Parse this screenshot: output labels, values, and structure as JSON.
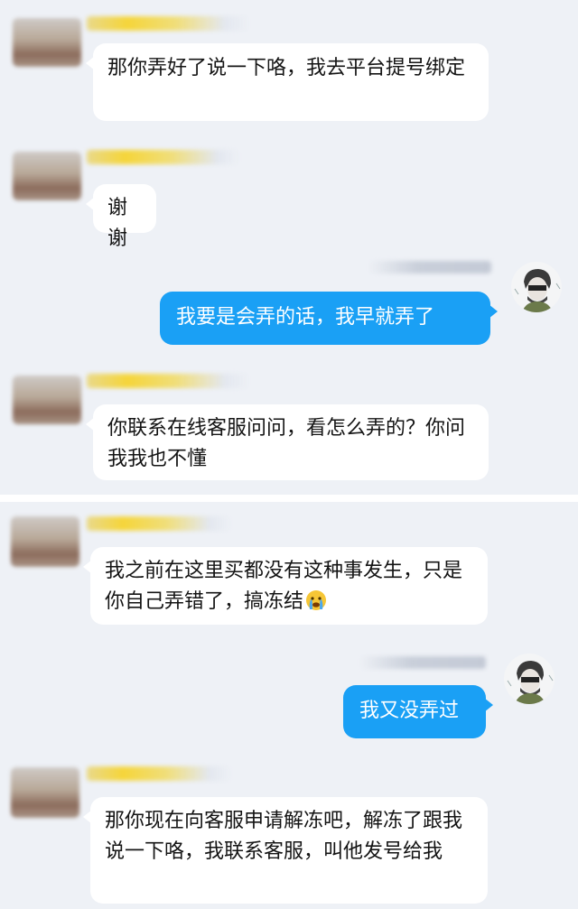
{
  "colors": {
    "chat_bg": "#eef1f6",
    "outgoing_bubble": "#1aa0f5",
    "incoming_bubble": "#ffffff"
  },
  "messages": [
    {
      "side": "in",
      "text": "那你弄好了说一下咯，我去平台提号绑定"
    },
    {
      "side": "in",
      "text": "谢谢"
    },
    {
      "side": "out",
      "text": "我要是会弄的话，我早就弄了"
    },
    {
      "side": "in",
      "text": "你联系在线客服问问，看怎么弄的？你问我我也不懂"
    },
    {
      "side": "in",
      "text": "我之前在这里买都没有这种事发生，只是你自己弄错了，搞冻结",
      "emoji": "crying-face-icon"
    },
    {
      "side": "out",
      "text": "我又没弄过"
    },
    {
      "side": "in",
      "text": "那你现在向客服申请解冻吧，解冻了跟我说一下咯，我联系客服，叫他发号给我"
    }
  ]
}
